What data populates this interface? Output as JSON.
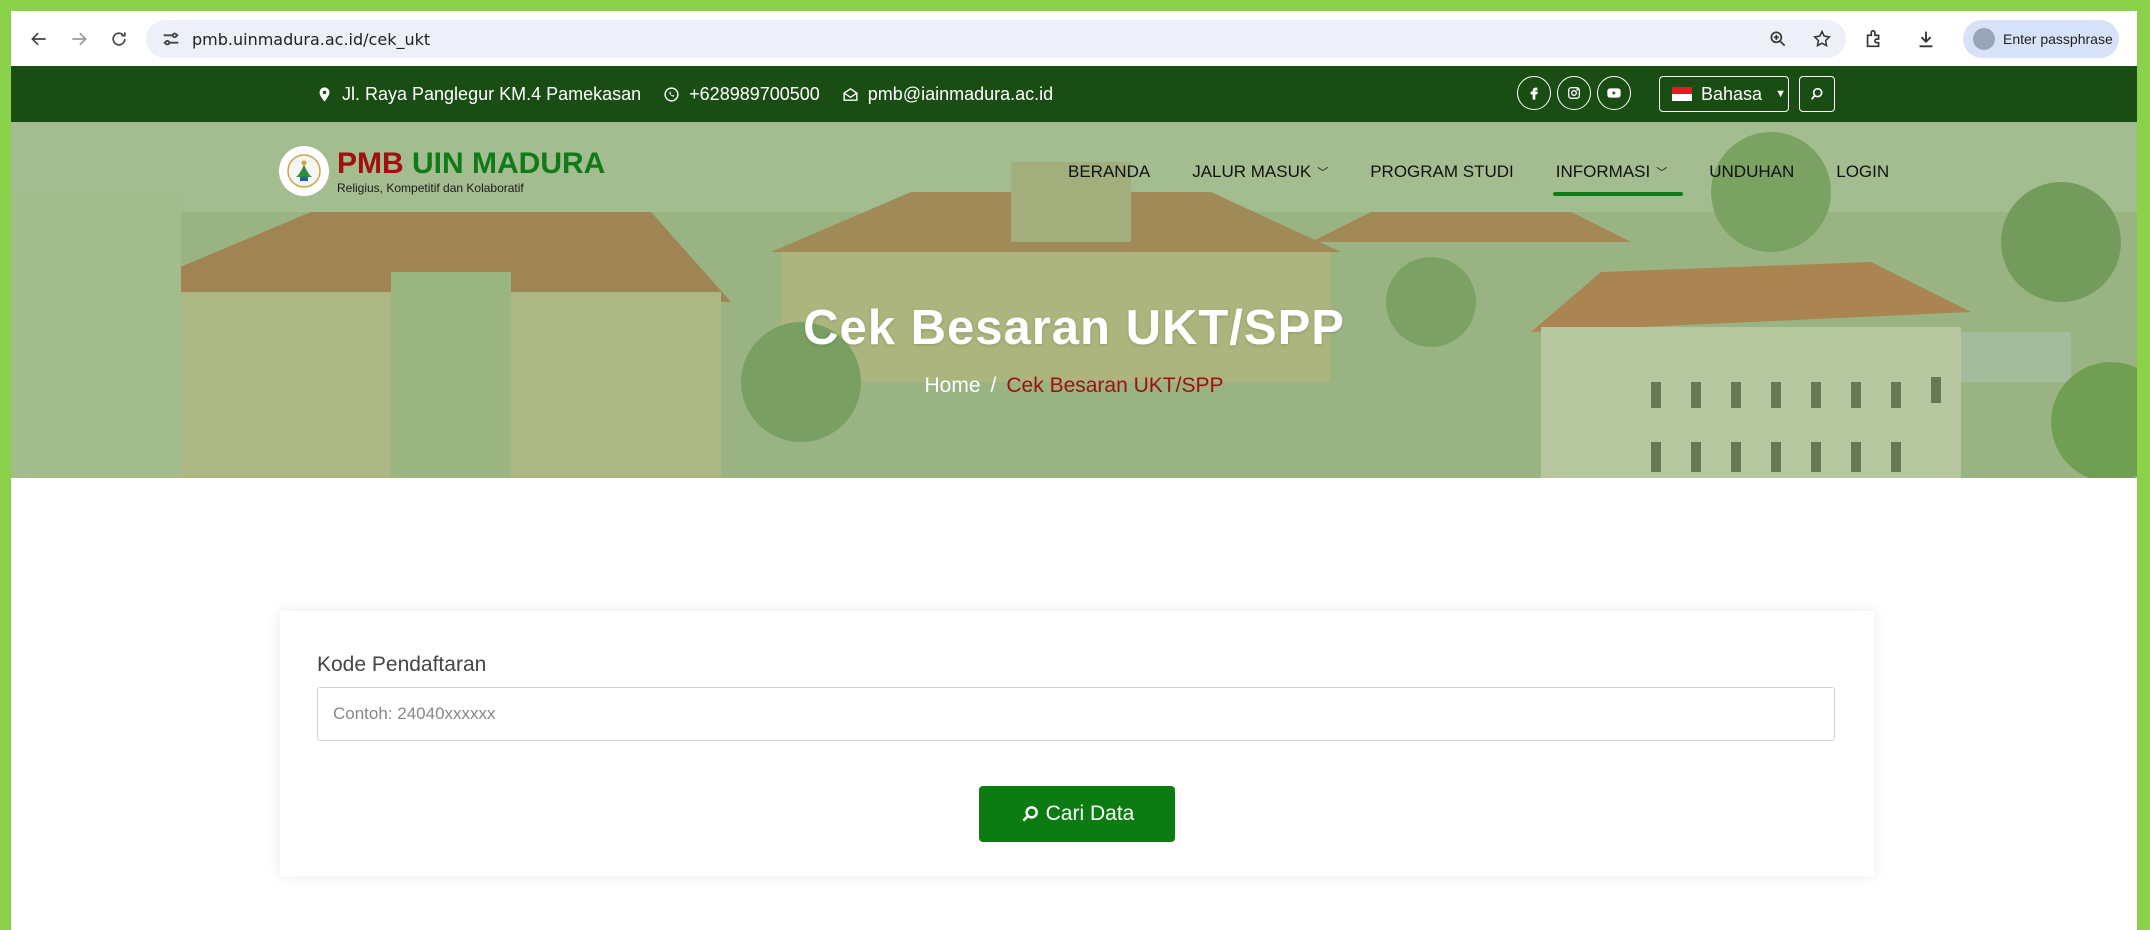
{
  "browser": {
    "url": "pmb.uinmadura.ac.id/cek_ukt",
    "profile_label": "Enter passphrase"
  },
  "topbar": {
    "address": "Jl. Raya Panglegur KM.4 Pamekasan",
    "phone": "+628989700500",
    "email": "pmb@iainmadura.ac.id",
    "language_label": "Bahasa"
  },
  "logo": {
    "pmb": "PMB",
    "uin": "UIN MADURA",
    "tagline": "Religius, Kompetitif dan Kolaboratif"
  },
  "nav": {
    "items": [
      {
        "label": "BERANDA"
      },
      {
        "label": "JALUR MASUK"
      },
      {
        "label": "PROGRAM STUDI"
      },
      {
        "label": "INFORMASI"
      },
      {
        "label": "UNDUHAN"
      },
      {
        "label": "LOGIN"
      }
    ],
    "active": "INFORMASI"
  },
  "hero": {
    "title": "Cek Besaran UKT/SPP",
    "breadcrumb_home": "Home",
    "breadcrumb_sep": "/",
    "breadcrumb_current": "Cek Besaran UKT/SPP"
  },
  "form": {
    "label": "Kode Pendaftaran",
    "placeholder": "Contoh: 24040xxxxxx",
    "value": "",
    "button_label": "Cari Data"
  },
  "colors": {
    "topbar_bg": "#1a4d14",
    "brand_red": "#a01010",
    "brand_green": "#117a18",
    "button_bg": "#0c7c12",
    "frame_border": "#8bd14a"
  }
}
